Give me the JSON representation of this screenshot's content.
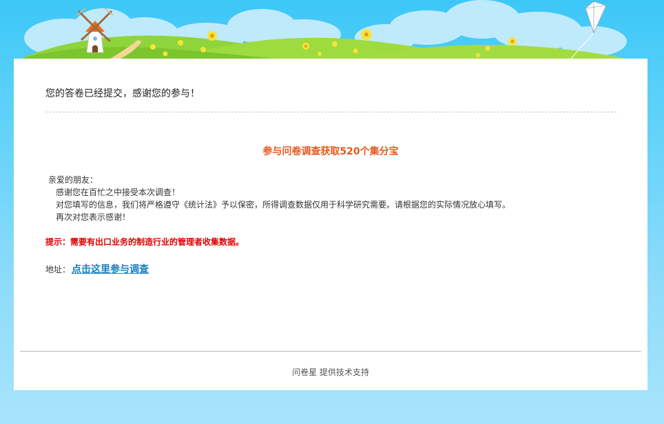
{
  "header": {
    "scene": [
      "windmill-icon",
      "cloud-icon",
      "hill-icon",
      "flower-icon",
      "kite-icon"
    ],
    "sky_color": "#3cc7f7"
  },
  "card": {
    "title": "您的答卷已经提交，感谢您的参与！",
    "headline": "参与问卷调查获取520个集分宝",
    "greeting": "亲爱的朋友：",
    "letter_lines": [
      "感谢您在百忙之中接受本次调查！",
      "对您填写的信息，我们将严格遵守《统计法》予以保密，所得调查数据仅用于科学研究需要。请根据您的实际情况放心填写。",
      "再次对您表示感谢！"
    ],
    "tip": "提示：需要有出口业务的制造行业的管理者收集数据。",
    "address_label": "地址：",
    "address_link": "点击这里参与调查",
    "headline_color": "#e8571d",
    "tip_color": "#e00000",
    "link_color": "#1a7fc0"
  },
  "footer": {
    "text": "问卷星 提供技术支持"
  }
}
